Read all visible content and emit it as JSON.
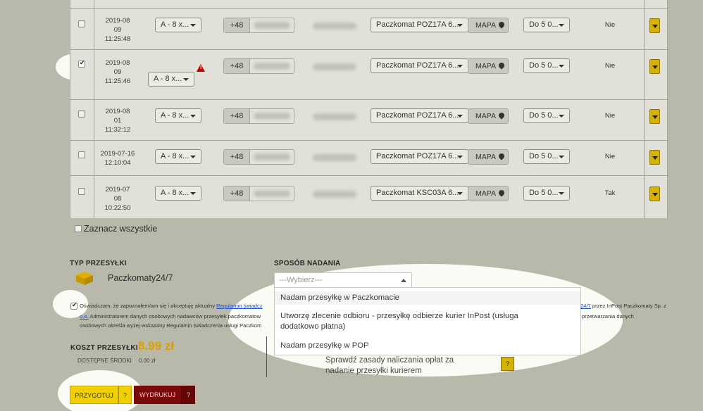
{
  "rows": [
    {
      "date": [
        "2019-08",
        "09",
        "11:25:48"
      ],
      "size": "A - 8 x...",
      "phone_prefix": "+48",
      "locker": "Paczkomat POZ17A 6...",
      "map_label": "MAPA",
      "insurance": "Do 5 0...",
      "status": "Nie",
      "checked": false,
      "warning": false
    },
    {
      "date": [
        "2019-08",
        "09",
        "11:25:46"
      ],
      "size": "A - 8 x...",
      "phone_prefix": "+48",
      "locker": "Paczkomat POZ17A 6...",
      "map_label": "MAPA",
      "insurance": "Do 5 0...",
      "status": "Nie",
      "checked": true,
      "warning": true
    },
    {
      "date": [
        "2019-08",
        "01",
        "11:32:12"
      ],
      "size": "A - 8 x...",
      "phone_prefix": "+48",
      "locker": "Paczkomat POZ17A 6...",
      "map_label": "MAPA",
      "insurance": "Do 5 0...",
      "status": "Nie",
      "checked": false,
      "warning": false
    },
    {
      "date": [
        "2019-07-16",
        "12:10:04"
      ],
      "size": "A - 8 x...",
      "phone_prefix": "+48",
      "locker": "Paczkomat POZ17A 6...",
      "map_label": "MAPA",
      "insurance": "Do 5 0...",
      "status": "Nie",
      "checked": false,
      "warning": false
    },
    {
      "date": [
        "2019-07",
        "08",
        "10:22:50"
      ],
      "size": "A - 8 x...",
      "phone_prefix": "+48",
      "locker": "Paczkomat KSC03A 6...",
      "map_label": "MAPA",
      "insurance": "Do 5 0...",
      "status": "Tak",
      "checked": false,
      "warning": false
    }
  ],
  "select_all": "Zaznacz wszystkie",
  "parcel_type": {
    "heading": "TYP PRZESYŁKI",
    "value": "Paczkomaty24/7",
    "icon": "box-icon"
  },
  "dispatch": {
    "heading": "SPOSÓB NADANIA",
    "placeholder": "---Wybierz---",
    "options": [
      "Nadam przesyłkę w Paczkomacie",
      "Utworzę zlecenie odbioru - przesyłkę odbierze kurier InPost (usługa dodatkowo płatna)",
      "Nadam przesyłkę w POP"
    ]
  },
  "consent": {
    "line1_a": "Oświadczam, że zapoznałem/am się i akceptuję aktualny",
    "line1_link": "Regulamin świadcz",
    "line1_right_link": "24/7",
    "line1_right": "przez InPost Paczkomaty Sp. z",
    "line2_link": "o.o.",
    "line2_a": "Administratorem danych osobowych nadawców przesyłek paczkomatow",
    "line2_right": "przetwarzania danych",
    "line3": "osobowych określa wyżej wskazany Regulamin świadczenia usługi Paczkom"
  },
  "cost": {
    "label": "KOSZT PRZESYŁKI",
    "value": "8.99 zł",
    "funds_label": "DOSTĘPNE ŚRODKI",
    "funds_value": "0.00 zł"
  },
  "hint": {
    "line1": "Sprawdź zasady naliczania opłat za",
    "line2": "nadanie przesyłki kurierem",
    "button": "?"
  },
  "buttons": {
    "prepare": "PRZYGOTUJ",
    "prepare_help": "?",
    "print": "WYDRUKUJ",
    "print_help": "?"
  },
  "colors": {
    "accent_yellow": "#e5c200",
    "print_red": "#7a0a0a",
    "cost_orange": "#d9a000",
    "link_blue": "#1d4fd1"
  }
}
